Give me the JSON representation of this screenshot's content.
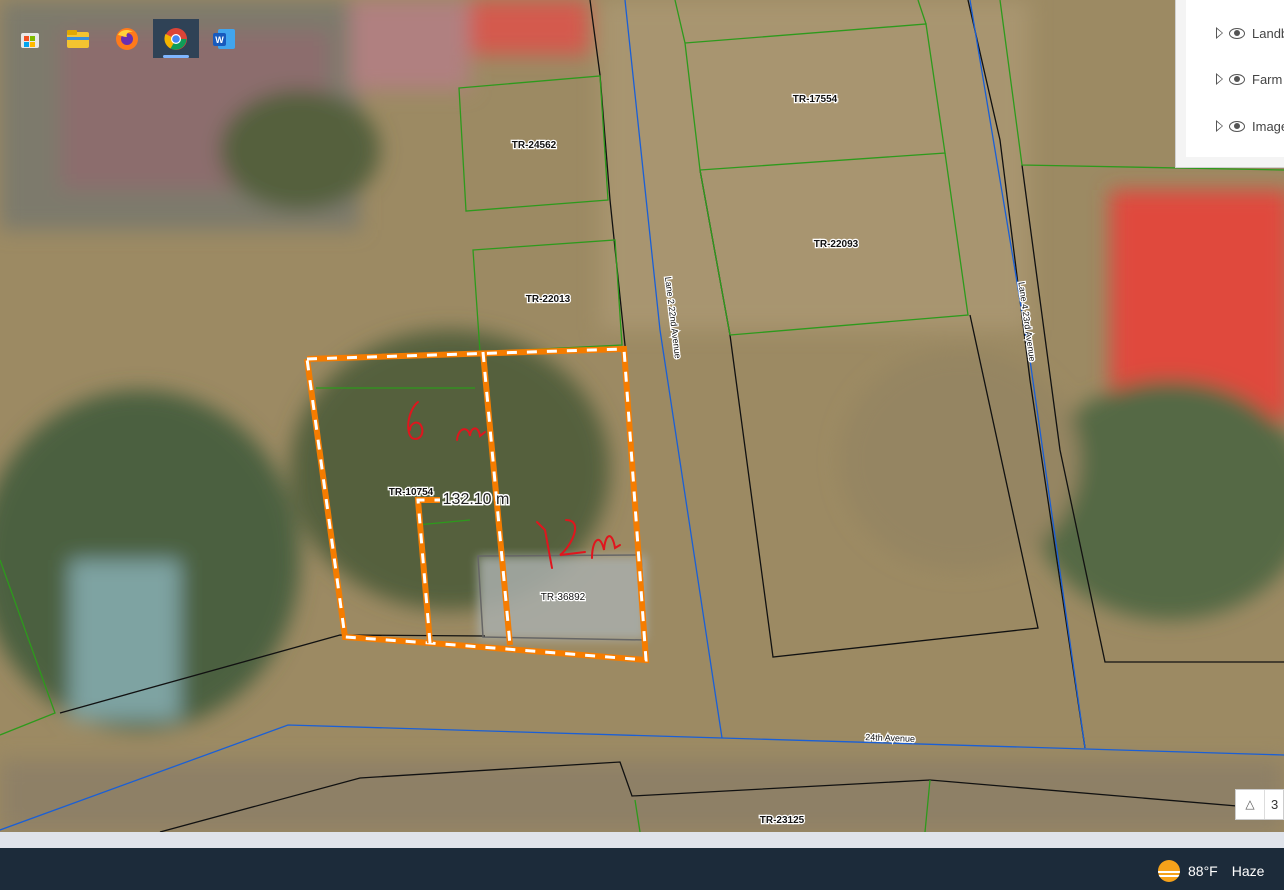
{
  "layer_panel": {
    "items": [
      {
        "label": "Landb"
      },
      {
        "label": "Farm l"
      },
      {
        "label": "Image"
      }
    ]
  },
  "map": {
    "parcel_labels": [
      {
        "id": "parcel-tr-24562",
        "text": "TR-24562"
      },
      {
        "id": "parcel-tr-17554",
        "text": "TR-17554"
      },
      {
        "id": "parcel-tr-22093",
        "text": "TR-22093"
      },
      {
        "id": "parcel-tr-22013",
        "text": "TR-22013"
      },
      {
        "id": "parcel-tr-10754",
        "text": "TR-10754"
      },
      {
        "id": "parcel-tr-36892",
        "text": "TR-36892"
      },
      {
        "id": "parcel-tr-23125",
        "text": "TR-23125"
      }
    ],
    "road_labels": [
      {
        "id": "road-lane-22nd",
        "text": "Lane 2 22nd Avenue"
      },
      {
        "id": "road-lane-23rd",
        "text": "Lane 4 23rd Avenue"
      },
      {
        "id": "road-24th",
        "text": "24th Avenue"
      }
    ],
    "measurement": "132.10 m",
    "annotations": [
      "6 m",
      "12 m"
    ],
    "colors": {
      "parcel_border": "#2d9a1c",
      "road_line": "#1a5fd6",
      "boundary": "#111111",
      "measure_outline": "#f57c00",
      "annotation_ink": "#e0151d"
    }
  },
  "zoom": {
    "value": "3"
  },
  "taskbar": {
    "apps": [
      {
        "icon": "store-icon"
      },
      {
        "icon": "file-explorer-icon"
      },
      {
        "icon": "firefox-icon"
      },
      {
        "icon": "chrome-icon"
      },
      {
        "icon": "word-icon"
      }
    ],
    "weather": {
      "temp": "88°F",
      "condition": "Haze"
    }
  }
}
